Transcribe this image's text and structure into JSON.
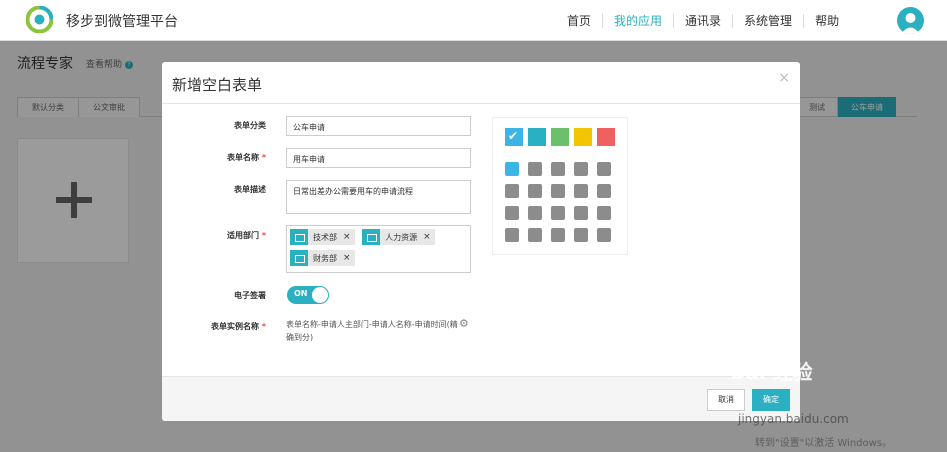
{
  "app": {
    "title": "移步到微管理平台"
  },
  "nav": {
    "items": [
      "首页",
      "我的应用",
      "通讯录",
      "系统管理",
      "帮助"
    ],
    "active": "我的应用"
  },
  "page": {
    "title": "流程专家",
    "help": "查看帮助"
  },
  "tabs": {
    "left": [
      "默认分类",
      "公文审批"
    ],
    "right": [
      "测试",
      "公车申请"
    ]
  },
  "modal": {
    "title": "新增空白表单",
    "close": "×",
    "fields": {
      "category_label": "表单分类",
      "category_value": "公车申请",
      "name_label": "表单名称",
      "name_value": "用车申请",
      "desc_label": "表单描述",
      "desc_value": "日常出差办公需要用车的申请流程",
      "dept_label": "适用部门",
      "depts": [
        "技术部",
        "人力资源",
        "财务部"
      ],
      "sign_label": "电子签署",
      "sign_value": "ON",
      "instance_label": "表单实例名称",
      "instance_value": "表单名称-申请人主部门-申请人名称-申请时间(精确到分)"
    },
    "required_marker": "*",
    "palette_colors": [
      "#3bb4e6",
      "#2ab0c0",
      "#6cc06c",
      "#f2c500",
      "#f06060"
    ],
    "icons": [
      "document-icon",
      "truck-icon",
      "pie-icon",
      "thumb-icon",
      "medkit-icon",
      "building-icon",
      "globe-icon",
      "group-icon",
      "clipboard-icon",
      "book-icon",
      "user-icon",
      "person-icon",
      "card-icon",
      "money-icon",
      "cart-icon",
      "stamp-icon",
      "chart-icon",
      "line-chart-icon",
      "coins-icon",
      "gauge-icon"
    ],
    "footer": {
      "cancel": "取消",
      "ok": "确定"
    }
  },
  "watermark": {
    "brand": "Bai 经验",
    "url": "jingyan.baidu.com",
    "win": "转到\"设置\"以激活 Windows。"
  }
}
